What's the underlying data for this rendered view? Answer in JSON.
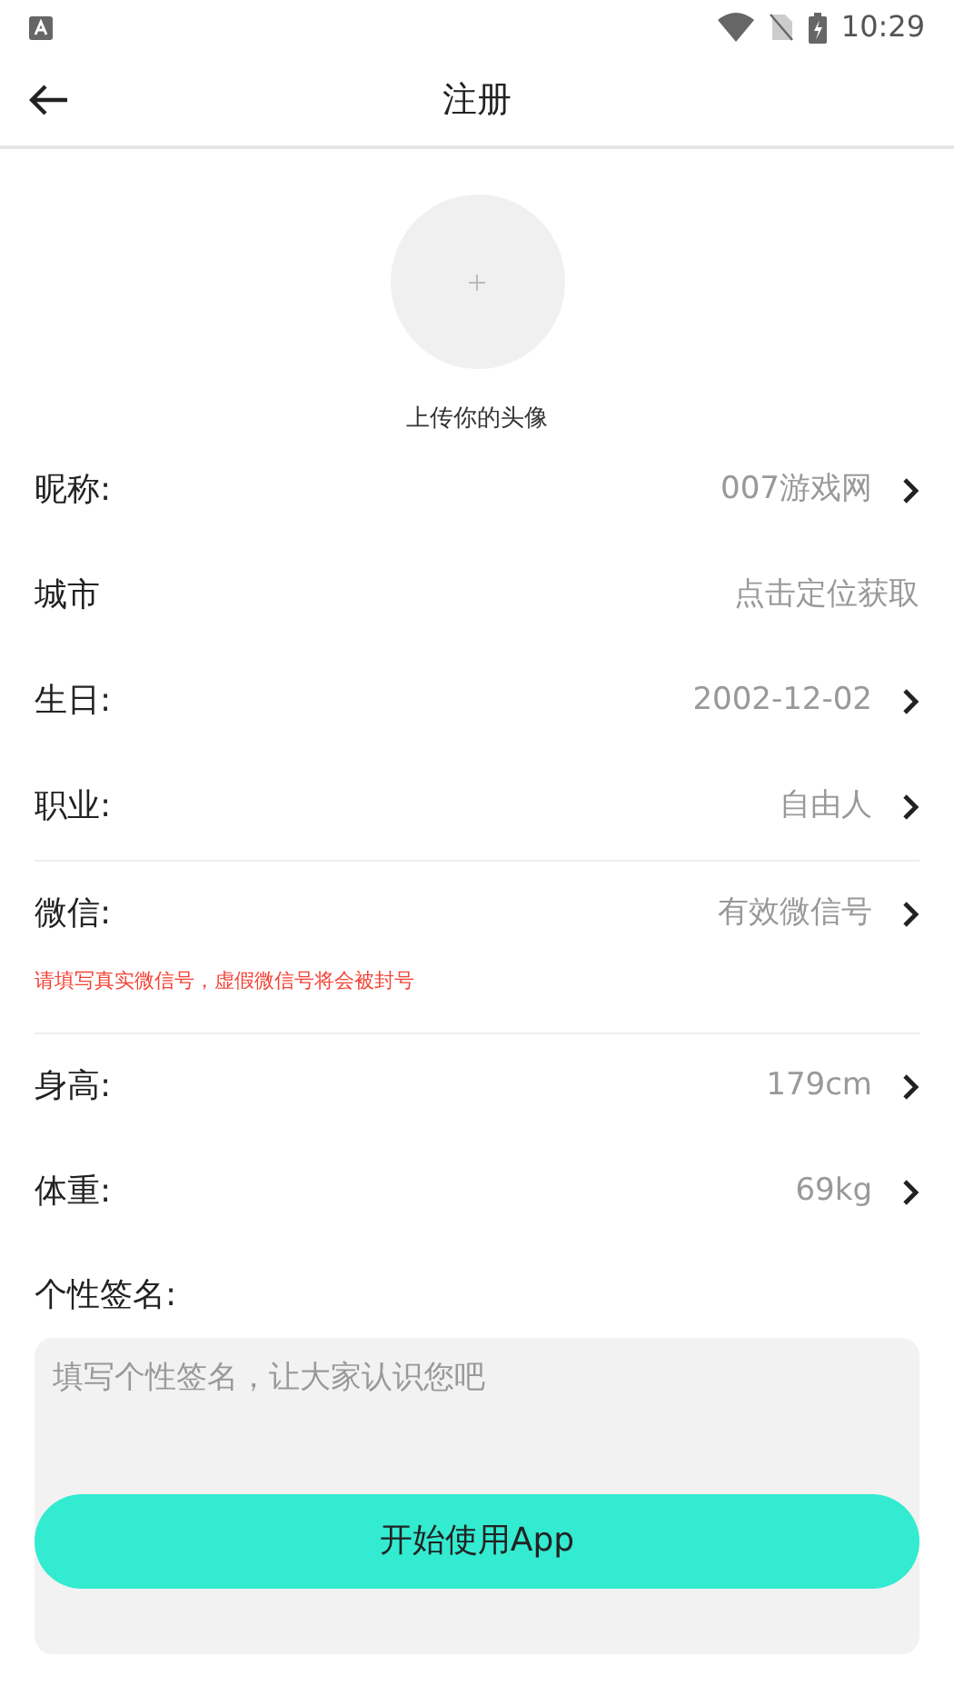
{
  "status_bar": {
    "time": "10:29"
  },
  "header": {
    "title": "注册"
  },
  "avatar": {
    "caption": "上传你的头像"
  },
  "fields": [
    {
      "label": "昵称:",
      "value": "007游戏网",
      "chevron": true,
      "divider_after": false
    },
    {
      "label": "城市",
      "value": "点击定位获取",
      "chevron": false,
      "divider_after": false
    },
    {
      "label": "生日:",
      "value": "2002-12-02",
      "chevron": true,
      "divider_after": false
    },
    {
      "label": "职业:",
      "value": "自由人",
      "chevron": true,
      "divider_after": true
    },
    {
      "label": "微信:",
      "value": "有效微信号",
      "chevron": true,
      "note": "请填写真实微信号，虚假微信号将会被封号",
      "divider_after": true
    },
    {
      "label": "身高:",
      "value": "179cm",
      "chevron": true,
      "divider_after": false
    },
    {
      "label": "体重:",
      "value": "69kg",
      "chevron": true,
      "divider_after": false
    }
  ],
  "signature": {
    "label": "个性签名:",
    "placeholder": "填写个性签名，让大家认识您吧"
  },
  "submit": {
    "label": "开始使用App"
  }
}
